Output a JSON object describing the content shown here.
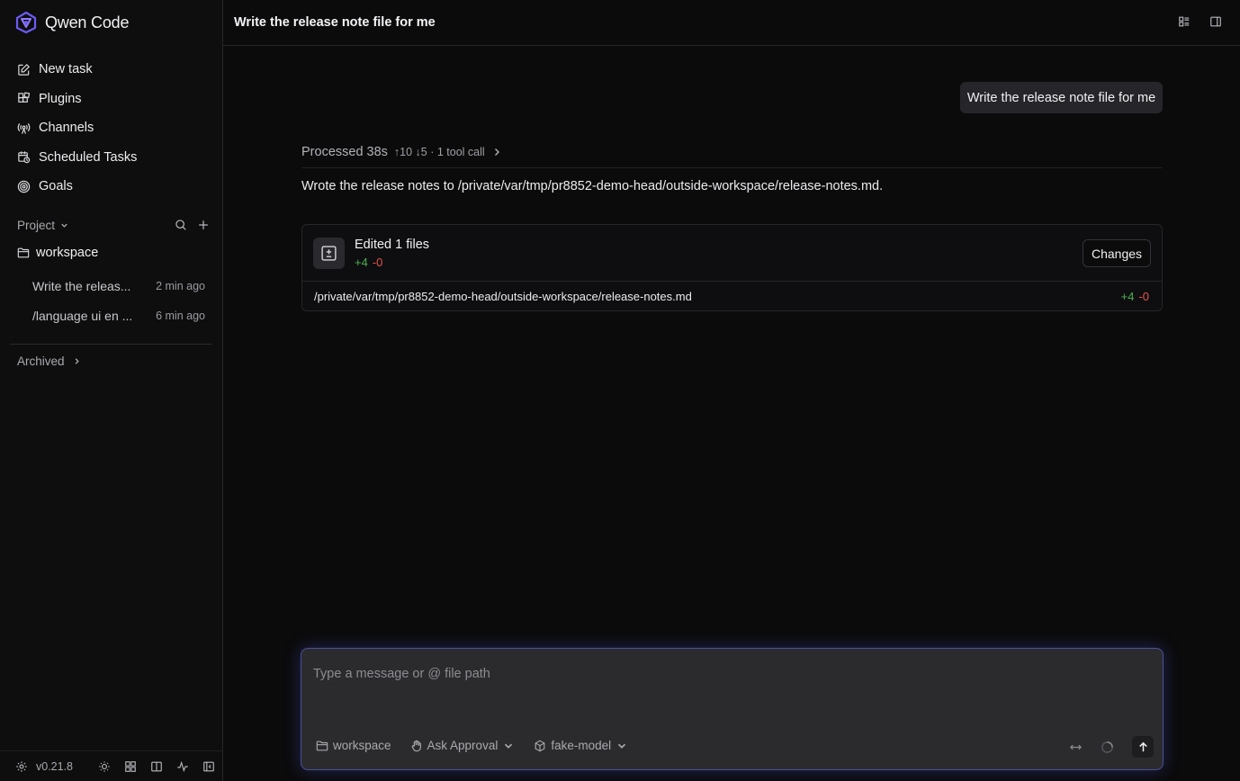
{
  "app": {
    "name": "Qwen Code",
    "version": "v0.21.8"
  },
  "sidebar": {
    "items": [
      {
        "label": "New task",
        "icon": "edit-icon"
      },
      {
        "label": "Plugins",
        "icon": "puzzle-icon"
      },
      {
        "label": "Channels",
        "icon": "broadcast-icon"
      },
      {
        "label": "Scheduled Tasks",
        "icon": "calendar-clock-icon"
      },
      {
        "label": "Goals",
        "icon": "target-icon"
      }
    ],
    "project_label": "Project",
    "folder": "workspace",
    "sessions": [
      {
        "title": "Write the releas...",
        "time": "2 min ago"
      },
      {
        "title": "/language ui en ...",
        "time": "6 min ago"
      }
    ],
    "archived_label": "Archived"
  },
  "header": {
    "title": "Write the release note file for me"
  },
  "chat": {
    "user_message": "Write the release note file for me",
    "processed": {
      "label": "Processed 38s",
      "stats": "↑10 ↓5 · 1 tool call"
    },
    "assistant_text": "Wrote the release notes to /private/var/tmp/pr8852-demo-head/outside-workspace/release-notes.md.",
    "edited": {
      "title": "Edited 1 files",
      "added": "+4",
      "removed": "-0",
      "changes_label": "Changes",
      "file_path": "/private/var/tmp/pr8852-demo-head/outside-workspace/release-notes.md",
      "file_added": "+4",
      "file_removed": "-0"
    }
  },
  "composer": {
    "placeholder": "Type a message or @ file path",
    "value": "",
    "folder": "workspace",
    "mode": "Ask Approval",
    "model": "fake-model"
  },
  "colors": {
    "accent": "#6b5cf6",
    "added": "#4caf50",
    "removed": "#e5534b",
    "border_glow": "#4a4f9a"
  }
}
